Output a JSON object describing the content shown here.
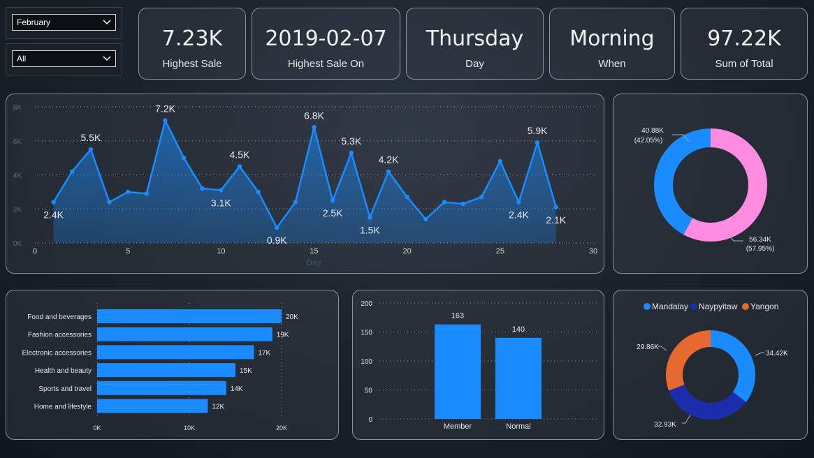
{
  "filters": {
    "month": {
      "value": "February"
    },
    "segment": {
      "value": "All"
    }
  },
  "kpis": [
    {
      "value": "7.23K",
      "label": "Highest Sale"
    },
    {
      "value": "2019-02-07",
      "label": "Highest Sale On"
    },
    {
      "value": "Thursday",
      "label": "Day"
    },
    {
      "value": "Morning",
      "label": "When"
    },
    {
      "value": "97.22K",
      "label": "Sum of Total"
    }
  ],
  "colors": {
    "line": "#1a8cff",
    "bar": "#1a8cff",
    "pink": "#ff8ce0",
    "mandalay": "#1a8cff",
    "naypyitaw": "#1a2daa",
    "yangon": "#e8692f"
  },
  "chart_data": [
    {
      "type": "area",
      "xlabel": "Day",
      "ylabel": "",
      "xlim": [
        0,
        30
      ],
      "ylim": [
        0,
        8000
      ],
      "x_ticks": [
        "0",
        "5",
        "10",
        "15",
        "20",
        "25",
        "30"
      ],
      "y_ticks": [
        "0K",
        "2K",
        "4K",
        "6K",
        "8K"
      ],
      "grid": true,
      "x": [
        1,
        2,
        3,
        4,
        5,
        6,
        7,
        8,
        9,
        10,
        11,
        12,
        13,
        14,
        15,
        16,
        17,
        18,
        19,
        20,
        21,
        22,
        23,
        24,
        25,
        26,
        27,
        28
      ],
      "values": [
        2400,
        4200,
        5500,
        2400,
        3000,
        2900,
        7200,
        5000,
        3200,
        3100,
        4500,
        3000,
        900,
        2400,
        6800,
        2500,
        5300,
        1500,
        4200,
        2700,
        1400,
        2400,
        2300,
        2700,
        4800,
        2400,
        5900,
        2100
      ],
      "data_labels": [
        {
          "x": 1,
          "text": "2.4K"
        },
        {
          "x": 3,
          "text": "5.5K"
        },
        {
          "x": 7,
          "text": "7.2K"
        },
        {
          "x": 10,
          "text": "3.1K"
        },
        {
          "x": 11,
          "text": "4.5K"
        },
        {
          "x": 13,
          "text": "0.9K"
        },
        {
          "x": 15,
          "text": "6.8K"
        },
        {
          "x": 16,
          "text": "2.5K"
        },
        {
          "x": 17,
          "text": "5.3K"
        },
        {
          "x": 18,
          "text": "1.5K"
        },
        {
          "x": 19,
          "text": "4.2K"
        },
        {
          "x": 26,
          "text": "2.4K"
        },
        {
          "x": 27,
          "text": "5.9K"
        },
        {
          "x": 28,
          "text": "2.1K"
        }
      ]
    },
    {
      "type": "pie",
      "donut": true,
      "slices": [
        {
          "value": 40.88,
          "label": "40.88K",
          "pct": "(42.05%)",
          "color": "#1a8cff"
        },
        {
          "value": 56.34,
          "label": "56.34K",
          "pct": "(57.95%)",
          "color": "#ff8ce0"
        }
      ]
    },
    {
      "type": "bar",
      "orientation": "horizontal",
      "categories": [
        "Food and beverages",
        "Fashion accessories",
        "Electronic accessories",
        "Health and beauty",
        "Sports and travel",
        "Home and lifestyle"
      ],
      "values": [
        20000,
        19000,
        17000,
        15000,
        14000,
        12000
      ],
      "data_labels": [
        "20K",
        "19K",
        "17K",
        "15K",
        "14K",
        "12K"
      ],
      "xlim": [
        0,
        20000
      ],
      "x_ticks": [
        "0K",
        "10K",
        "20K"
      ],
      "grid": true
    },
    {
      "type": "bar",
      "categories": [
        "Member",
        "Normal"
      ],
      "values": [
        163,
        140
      ],
      "data_labels": [
        "163",
        "140"
      ],
      "ylim": [
        0,
        200
      ],
      "y_ticks": [
        "0",
        "50",
        "100",
        "150",
        "200"
      ],
      "grid": true
    },
    {
      "type": "pie",
      "donut": true,
      "legend": "top",
      "legend_entries": [
        "Mandalay",
        "Naypyitaw",
        "Yangon"
      ],
      "slices": [
        {
          "name": "Mandalay",
          "value": 34.42,
          "label": "34.42K",
          "color": "#1a8cff"
        },
        {
          "name": "Naypyitaw",
          "value": 32.93,
          "label": "32.93K",
          "color": "#1a2daa"
        },
        {
          "name": "Yangon",
          "value": 29.86,
          "label": "29.86K",
          "color": "#e8692f"
        }
      ]
    }
  ]
}
